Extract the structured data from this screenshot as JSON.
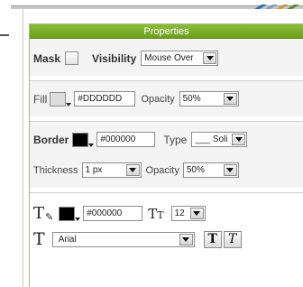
{
  "panel": {
    "title": "Properties"
  },
  "mask": {
    "label": "Mask",
    "checked": false
  },
  "visibility": {
    "label": "Visibility",
    "value": "Mouse Over"
  },
  "fill": {
    "label": "Fill",
    "color": "#DDDDDD",
    "hex_value": "#DDDDDD",
    "opacity_label": "Opacity",
    "opacity": "50%"
  },
  "border": {
    "label": "Border",
    "color": "#000000",
    "hex_value": "#000000",
    "type_label": "Type",
    "type_value": "___ Soli",
    "thickness_label": "Thickness",
    "thickness": "1 px",
    "opacity_label": "Opacity",
    "opacity": "50%"
  },
  "text": {
    "color": "#000000",
    "hex_value": "#000000",
    "size_value": "12",
    "font_value": "Arial",
    "bold_label": "T",
    "italic_label": "T"
  },
  "icons": {
    "font_color": "font-color-icon",
    "font_size": "font-size-icon",
    "font_family": "font-family-icon"
  },
  "colors": {
    "header": "#7aae2a",
    "panel_border": "#a4b97a"
  }
}
